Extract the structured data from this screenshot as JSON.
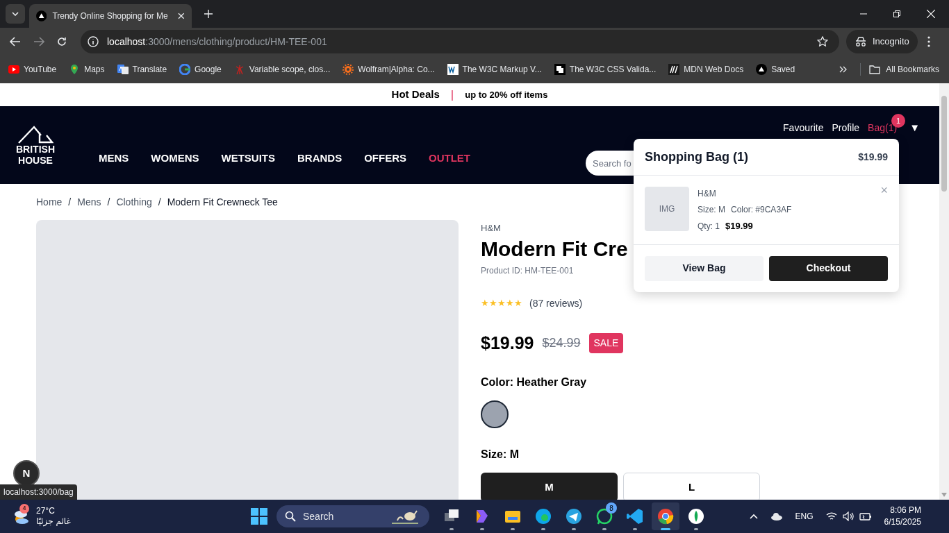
{
  "browser": {
    "tab": {
      "title": "Trendy Online Shopping for Me"
    },
    "address": {
      "host": "localhost",
      "path": ":3000/mens/clothing/product/HM-TEE-001"
    },
    "profile": "Incognito",
    "bookmarks": [
      {
        "label": "YouTube"
      },
      {
        "label": "Maps"
      },
      {
        "label": "Translate"
      },
      {
        "label": "Google"
      },
      {
        "label": "Variable scope, clos..."
      },
      {
        "label": "Wolfram|Alpha: Co..."
      },
      {
        "label": "The W3C Markup V..."
      },
      {
        "label": "The W3C CSS Valida..."
      },
      {
        "label": "MDN Web Docs"
      },
      {
        "label": "Saved"
      }
    ],
    "all_bookmarks": "All Bookmarks"
  },
  "promo": {
    "title": "Hot Deals",
    "separator": "|",
    "text": "up to 20% off items"
  },
  "header": {
    "logo": {
      "line1": "BRITISH",
      "line2": "HOUSE"
    },
    "nav": [
      {
        "label": "MENS",
        "highlight": false
      },
      {
        "label": "WOMENS",
        "highlight": false
      },
      {
        "label": "WETSUITS",
        "highlight": false
      },
      {
        "label": "BRANDS",
        "highlight": false
      },
      {
        "label": "OFFERS",
        "highlight": false
      },
      {
        "label": "OUTLET",
        "highlight": true
      }
    ],
    "links": [
      {
        "label": "Favourite",
        "active": false
      },
      {
        "label": "Profile",
        "active": false
      },
      {
        "label": "Bag(1)",
        "active": true
      }
    ],
    "bag_badge": "1",
    "menu_toggle": "▼",
    "search": {
      "placeholder": "Search fo"
    }
  },
  "breadcrumb": [
    {
      "label": "Home",
      "current": false
    },
    {
      "separator": "/",
      "label": "Mens",
      "current": false
    },
    {
      "separator": "/",
      "label": "Clothing",
      "current": false
    },
    {
      "separator": "/",
      "label": "Modern Fit Crewneck Tee",
      "current": true
    }
  ],
  "product": {
    "brand": "H&M",
    "title": "Modern Fit Cre",
    "product_id": "Product ID: HM-TEE-001",
    "stars": 5,
    "reviews": "(87 reviews)",
    "price": "$19.99",
    "old_price": "$24.99",
    "badge": "SALE",
    "color_label": "Color: Heather Gray",
    "colors": [
      {
        "color": "#9ca3af",
        "selected": true
      }
    ],
    "size_label": "Size: M",
    "sizes": [
      {
        "label": "M",
        "selected": true
      },
      {
        "label": "L",
        "selected": false
      }
    ]
  },
  "bag_popup": {
    "title": "Shopping Bag (1)",
    "total": "$19.99",
    "items": [
      {
        "image": "IMG",
        "brand": "H&M",
        "size": "Size: M",
        "color_text": "Color: #9CA3AF",
        "qty": "Qty: 1",
        "price": "$19.99",
        "remove": "×"
      }
    ],
    "view_button": "View Bag",
    "checkout_button": "Checkout"
  },
  "dev_indicator": "N",
  "link_preview": "localhost:3000/bag",
  "taskbar": {
    "weather": {
      "temp": "27°C",
      "condition": "غائم جزئيًا",
      "badge": "4"
    },
    "search": "Search",
    "apps": [
      {
        "kind": "task-view",
        "active": false
      },
      {
        "kind": "copilot",
        "active": false
      },
      {
        "kind": "file-explorer",
        "active": false
      },
      {
        "kind": "edge",
        "active": false
      },
      {
        "kind": "telegram",
        "active": false
      },
      {
        "kind": "whatsapp",
        "badge": "8",
        "active": false
      },
      {
        "kind": "vscode",
        "active": false
      },
      {
        "kind": "chrome",
        "active": true
      },
      {
        "kind": "mongodb",
        "active": false
      }
    ],
    "language": "ENG",
    "time": "8:06 PM",
    "date": "6/15/2025"
  }
}
